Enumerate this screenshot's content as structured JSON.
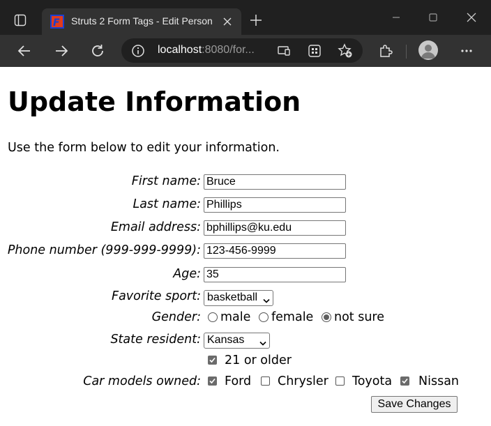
{
  "browser": {
    "tab_title": "Struts 2 Form Tags - Edit Person",
    "url_host": "localhost",
    "url_rest": ":8080/for..."
  },
  "page": {
    "heading": "Update Information",
    "intro": "Use the form below to edit your information."
  },
  "form": {
    "first_name": {
      "label": "First name:",
      "value": "Bruce"
    },
    "last_name": {
      "label": "Last name:",
      "value": "Phillips"
    },
    "email": {
      "label": "Email address:",
      "value": "bphillips@ku.edu"
    },
    "phone": {
      "label": "Phone number (999-999-9999):",
      "value": "123-456-9999"
    },
    "age": {
      "label": "Age:",
      "value": "35"
    },
    "sport": {
      "label": "Favorite sport:",
      "selected": "basketball"
    },
    "gender": {
      "label": "Gender:",
      "options": [
        {
          "label": "male",
          "checked": false
        },
        {
          "label": "female",
          "checked": false
        },
        {
          "label": "not sure",
          "checked": true
        }
      ]
    },
    "state": {
      "label": "State resident:",
      "selected": "Kansas"
    },
    "over21": {
      "label": "21 or older",
      "checked": true
    },
    "cars": {
      "label": "Car models owned:",
      "options": [
        {
          "label": "Ford",
          "checked": true
        },
        {
          "label": "Chrysler",
          "checked": false
        },
        {
          "label": "Toyota",
          "checked": false
        },
        {
          "label": "Nissan",
          "checked": true
        }
      ]
    },
    "submit_label": "Save Changes"
  }
}
